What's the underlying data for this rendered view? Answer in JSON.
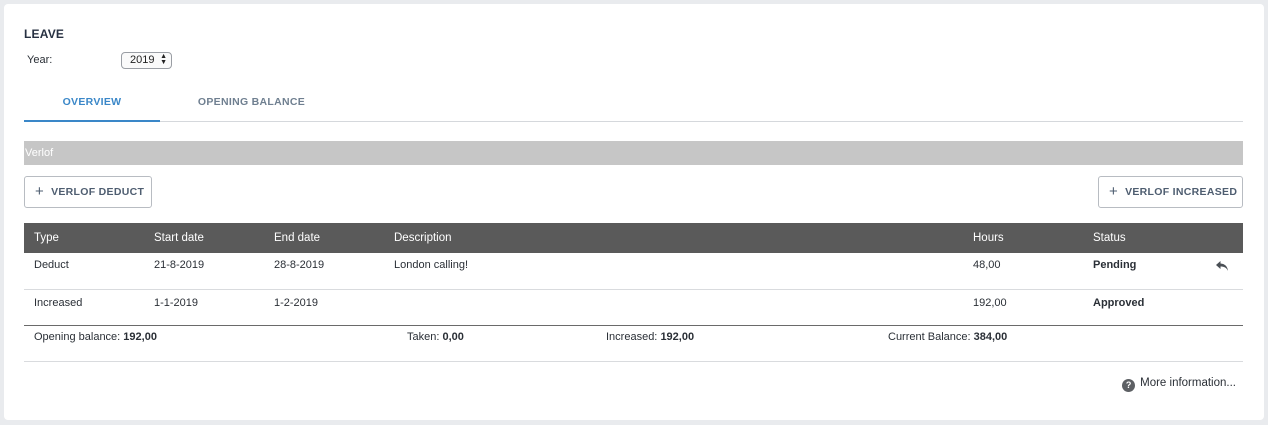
{
  "page": {
    "title": "LEAVE"
  },
  "year": {
    "label": "Year:",
    "value": "2019"
  },
  "tabs": [
    {
      "label": "OVERVIEW",
      "active": true
    },
    {
      "label": "OPENING BALANCE",
      "active": false
    }
  ],
  "section": {
    "title": "Verlof"
  },
  "buttons": {
    "deduct": "VERLOF DEDUCT",
    "increased": "VERLOF INCREASED"
  },
  "table": {
    "headers": [
      "Type",
      "Start date",
      "End date",
      "Description",
      "Hours",
      "Status"
    ],
    "rows": [
      {
        "type": "Deduct",
        "start": "21-8-2019",
        "end": "28-8-2019",
        "description": "London calling!",
        "hours": "48,00",
        "status": "Pending",
        "action_icon": "undo-icon"
      },
      {
        "type": "Increased",
        "start": "1-1-2019",
        "end": "1-2-2019",
        "description": "",
        "hours": "192,00",
        "status": "Approved"
      }
    ]
  },
  "summary": {
    "opening_label": "Opening balance:",
    "opening_value": "192,00",
    "taken_label": "Taken:",
    "taken_value": "0,00",
    "increased_label": "Increased:",
    "increased_value": "192,00",
    "current_label": "Current Balance:",
    "current_value": "384,00"
  },
  "more_info": {
    "label": "More information...",
    "icon": "question-icon"
  },
  "colors": {
    "accent": "#3a87c8",
    "pending": "#f29d2f",
    "approved": "#2e8f34",
    "header_bg": "#5a5a5a",
    "section_bg": "#c6c6c6"
  }
}
